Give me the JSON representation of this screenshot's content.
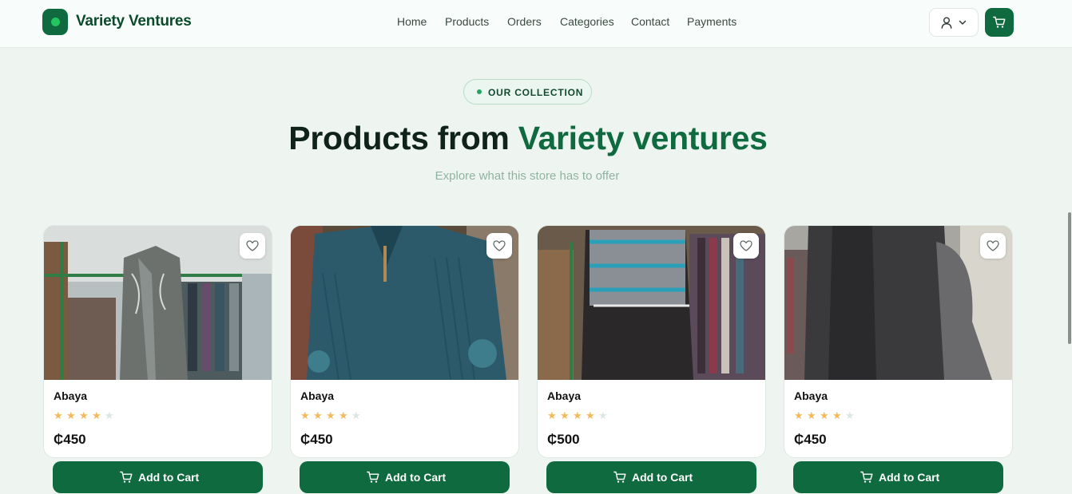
{
  "header": {
    "brand": "Variety Ventures",
    "nav": [
      "Home",
      "Products",
      "Orders",
      "Categories",
      "Contact",
      "Payments"
    ],
    "brand_color": "#0f6a3f"
  },
  "hero": {
    "pill": "OUR COLLECTION",
    "title_prefix": "Products from ",
    "title_accent": "Variety ventures",
    "subtitle": "Explore what this store has to offer"
  },
  "products": [
    {
      "name": "Abaya",
      "rating": 4,
      "max_rating": 5,
      "price": "₵450",
      "button": "Add to Cart"
    },
    {
      "name": "Abaya",
      "rating": 4,
      "max_rating": 5,
      "price": "₵450",
      "button": "Add to Cart"
    },
    {
      "name": "Abaya",
      "rating": 4,
      "max_rating": 5,
      "price": "₵500",
      "button": "Add to Cart"
    },
    {
      "name": "Abaya",
      "rating": 4,
      "max_rating": 5,
      "price": "₵450",
      "button": "Add to Cart"
    }
  ],
  "icons": {
    "user": "user-icon",
    "chevron": "chevron-down-icon",
    "cart": "cart-icon",
    "favorite": "heart-icon",
    "star": "star-icon"
  },
  "colors": {
    "accent": "#0f6a3f",
    "star_filled": "#f5b95a",
    "star_empty": "#dce7e2"
  }
}
